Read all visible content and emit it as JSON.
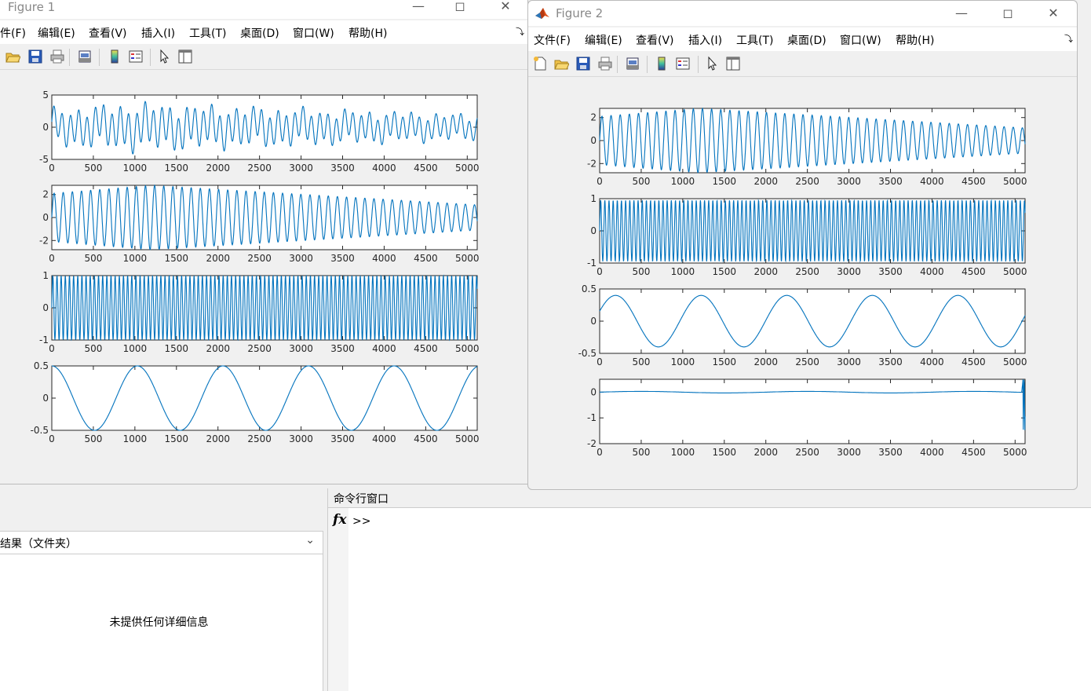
{
  "colors": {
    "line": "#0072bd",
    "axes": "#262626"
  },
  "icons": [
    "new-figure-icon",
    "open-icon",
    "save-icon",
    "print-icon",
    "print-preview-icon",
    "colorbar-icon",
    "legend-icon",
    "pointer-icon",
    "property-editor-icon"
  ],
  "menu": [
    "文件(F)",
    "编辑(E)",
    "查看(V)",
    "插入(I)",
    "工具(T)",
    "桌面(D)",
    "窗口(W)",
    "帮助(H)"
  ],
  "fig1": {
    "title": "Figure 1",
    "menu_first": "件(F)",
    "chart_data": [
      {
        "type": "line",
        "x_range": [
          0,
          5120
        ],
        "ylim": [
          -5,
          5
        ],
        "yticks": [
          "5",
          "0",
          "-5"
        ],
        "xticks": [
          "0",
          "500",
          "1000",
          "1500",
          "2000",
          "2500",
          "3000",
          "3500",
          "4000",
          "4500",
          "5000"
        ],
        "series": [
          {
            "components": [
              {
                "period": 100,
                "amp": 2.2
              },
              {
                "period": 270,
                "amp": 0.7
              },
              {
                "period": 600,
                "amp": 0.4
              }
            ],
            "envelope": {
              "start": 1.0,
              "peak_at": 1000,
              "peak": 1.3,
              "end": 0.7
            }
          }
        ]
      },
      {
        "type": "line",
        "x_range": [
          0,
          5120
        ],
        "ylim": [
          -2.8,
          2.8
        ],
        "yticks": [
          "2",
          "0",
          "-2"
        ],
        "xticks": [
          "0",
          "500",
          "1000",
          "1500",
          "2000",
          "2500",
          "3000",
          "3500",
          "4000",
          "4500",
          "5000"
        ],
        "series": [
          {
            "components": [
              {
                "period": 110,
                "amp": 1.0
              }
            ],
            "envelope": {
              "start": 2.1,
              "peak_at": 1200,
              "peak": 2.8,
              "end": 1.1
            }
          }
        ]
      },
      {
        "type": "line",
        "x_range": [
          0,
          5120
        ],
        "ylim": [
          -1,
          1
        ],
        "yticks": [
          "1",
          "0",
          "-1"
        ],
        "xticks": [
          "0",
          "500",
          "1000",
          "1500",
          "2000",
          "2500",
          "3000",
          "3500",
          "4000",
          "4500",
          "5000"
        ],
        "series": [
          {
            "components": [
              {
                "period": 50,
                "amp": 1.0
              }
            ]
          }
        ]
      },
      {
        "type": "line",
        "x_range": [
          0,
          5120
        ],
        "ylim": [
          -0.5,
          0.5
        ],
        "yticks": [
          "0.5",
          "0",
          "-0.5"
        ],
        "xticks": [
          "0",
          "500",
          "1000",
          "1500",
          "2000",
          "2500",
          "3000",
          "3500",
          "4000",
          "4500",
          "5000"
        ],
        "series": [
          {
            "components": [
              {
                "period": 1030,
                "amp": 0.5,
                "phase": "cos"
              }
            ]
          }
        ]
      }
    ]
  },
  "fig2": {
    "title": "Figure 2",
    "chart_data": [
      {
        "type": "line",
        "x_range": [
          0,
          5120
        ],
        "ylim": [
          -2.8,
          2.8
        ],
        "yticks": [
          "2",
          "0",
          "-2"
        ],
        "xticks": [
          "0",
          "500",
          "1000",
          "1500",
          "2000",
          "2500",
          "3000",
          "3500",
          "4000",
          "4500",
          "5000"
        ],
        "series": [
          {
            "components": [
              {
                "period": 110,
                "amp": 1.0
              }
            ],
            "envelope": {
              "start": 2.1,
              "peak_at": 1200,
              "peak": 2.8,
              "end": 1.1
            }
          }
        ]
      },
      {
        "type": "line",
        "x_range": [
          0,
          5120
        ],
        "ylim": [
          -1,
          1
        ],
        "yticks": [
          "1",
          "0",
          "-1"
        ],
        "xticks": [
          "0",
          "500",
          "1000",
          "1500",
          "2000",
          "2500",
          "3000",
          "3500",
          "4000",
          "4500",
          "5000"
        ],
        "series": [
          {
            "components": [
              {
                "period": 50,
                "amp": 0.95
              }
            ]
          }
        ]
      },
      {
        "type": "line",
        "x_range": [
          0,
          5120
        ],
        "ylim": [
          -0.5,
          0.5
        ],
        "yticks": [
          "0.5",
          "0",
          "-0.5"
        ],
        "xticks": [
          "0",
          "500",
          "1000",
          "1500",
          "2000",
          "2500",
          "3000",
          "3500",
          "4000",
          "4500",
          "5000"
        ],
        "series": [
          {
            "components": [
              {
                "period": 1030,
                "amp": 0.4,
                "phase": "sin-shift"
              }
            ]
          }
        ]
      },
      {
        "type": "line",
        "x_range": [
          0,
          5120
        ],
        "ylim": [
          -2,
          0.5
        ],
        "yticks": [
          "0",
          "-1",
          "-2"
        ],
        "xticks": [
          "0",
          "500",
          "1000",
          "1500",
          "2000",
          "2500",
          "3000",
          "3500",
          "4000",
          "4500",
          "5000"
        ],
        "series": [
          {
            "components": [
              {
                "period": 2000,
                "amp": 0.03
              }
            ],
            "edge_spike": {
              "at": 5080,
              "min": -1.8,
              "max": 0.5
            }
          }
        ]
      }
    ]
  },
  "current_folder": {
    "header": "结果（文件夹）",
    "empty_message": "未提供任何详细信息"
  },
  "command_window": {
    "title": "命令行窗口",
    "fx": "fx",
    "prompt": ">>"
  }
}
